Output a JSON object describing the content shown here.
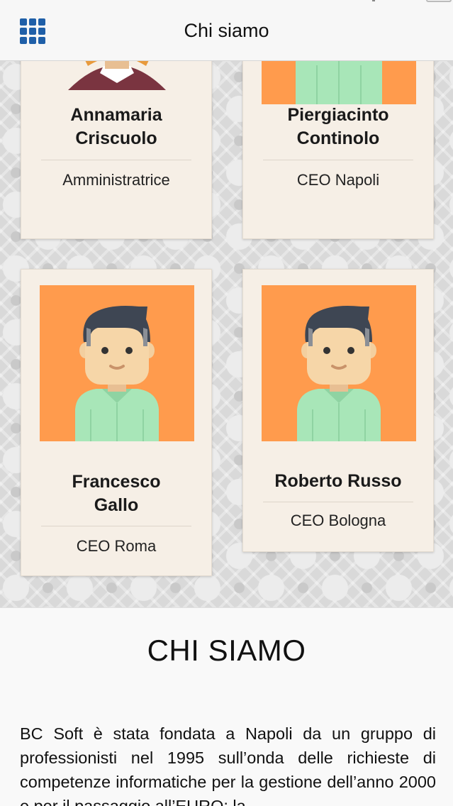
{
  "header": {
    "title": "Chi siamo",
    "menu_icon": "grid-menu-icon",
    "accent_color": "#1f5fa8"
  },
  "team": [
    {
      "name_line1": "Annamaria",
      "name_line2": "Criscuolo",
      "role": "Amministratrice",
      "avatar": "female-avatar"
    },
    {
      "name_line1": "Piergiacinto",
      "name_line2": "Continolo",
      "role": "CEO Napoli",
      "avatar": "male-avatar"
    },
    {
      "name_line1": "Francesco",
      "name_line2": "Gallo",
      "role": "CEO Roma",
      "avatar": "male-avatar"
    },
    {
      "name_line1": "Roberto Russo",
      "name_line2": "",
      "role": "CEO Bologna",
      "avatar": "male-avatar"
    }
  ],
  "about": {
    "title": "CHI SIAMO",
    "text": "BC Soft è stata fondata a Napoli da un gruppo di professionisti nel 1995 sull’onda delle richieste di competenze informatiche per la gestione dell’anno 2000 e per il passaggio all’EURO; la"
  },
  "colors": {
    "card_bg": "#f6efe6",
    "avatar_bg": "#ff9b4d"
  }
}
